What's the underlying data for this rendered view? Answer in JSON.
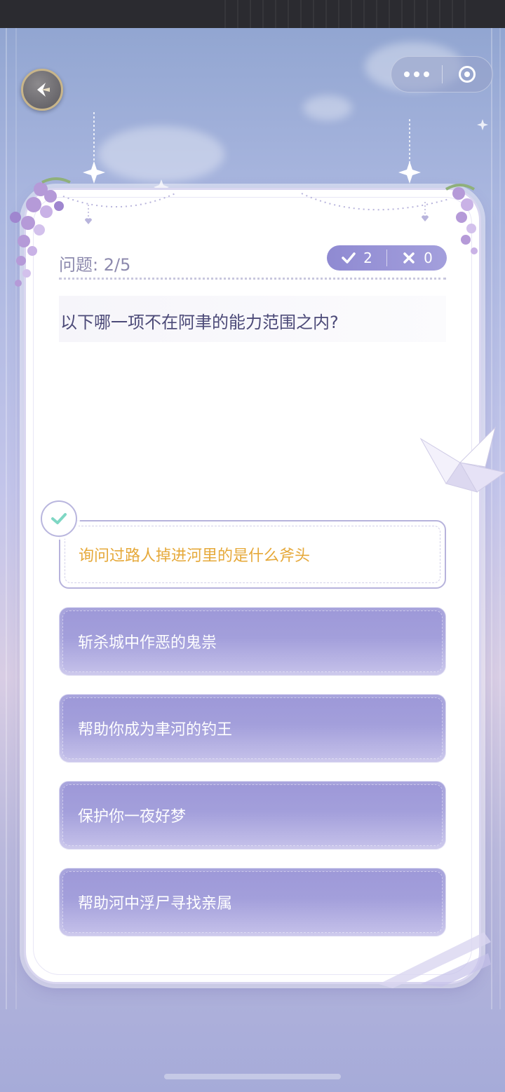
{
  "quiz": {
    "counter_label": "问题: 2/5",
    "correct_count": "2",
    "wrong_count": "0",
    "question": "以下哪一项不在阿聿的能力范围之内?",
    "options": [
      {
        "text": "询问过路人掉进河里的是什么斧头",
        "selected": true
      },
      {
        "text": "斩杀城中作恶的鬼祟",
        "selected": false
      },
      {
        "text": "帮助你成为聿河的钓王",
        "selected": false
      },
      {
        "text": "保护你一夜好梦",
        "selected": false
      },
      {
        "text": "帮助河中浮尸寻找亲属",
        "selected": false
      }
    ]
  },
  "icons": {
    "back": "back-arrow-icon",
    "more": "more-dots-icon",
    "close": "close-target-icon",
    "correct": "check-icon",
    "wrong": "x-icon",
    "selected": "check-icon"
  },
  "colors": {
    "accent": "#9d98d8",
    "selected_text": "#e6a93a",
    "question_text": "#4c4a78",
    "check_mint": "#7fd7c4"
  }
}
